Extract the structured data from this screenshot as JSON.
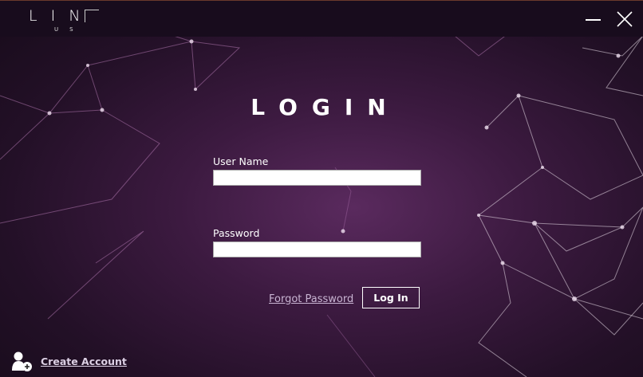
{
  "app": {
    "logo_main": "LIN",
    "logo_sub": "US"
  },
  "window": {
    "minimize_icon": "minimize-icon",
    "close_icon": "close-icon"
  },
  "login": {
    "title": "LOGIN",
    "username_label": "User Name",
    "username_value": "",
    "password_label": "Password",
    "password_value": "",
    "forgot_label": "Forgot Password",
    "login_label": "Log In"
  },
  "footer": {
    "create_account_label": "Create Account",
    "create_account_icon": "add-user-icon"
  },
  "colors": {
    "background": "#3c1a40",
    "titlebar": "#180c1d",
    "link": "#c8b4d2"
  }
}
